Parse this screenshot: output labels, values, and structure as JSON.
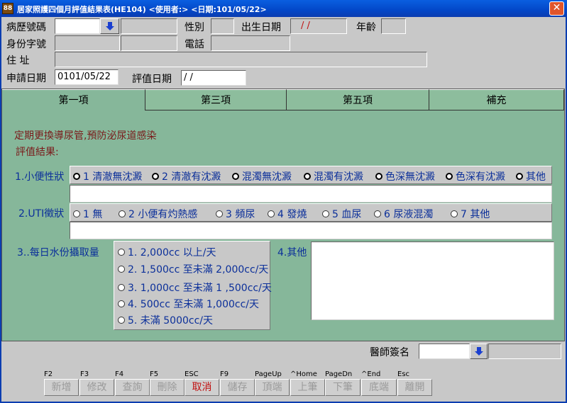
{
  "window": {
    "title": "居家照護四個月評值結果表(HE104)   <使用者:>    <日期:101/05/22>",
    "app_icon_text": "88",
    "close_label": "✕"
  },
  "header": {
    "record_no_label": "病歷號碼",
    "gender_label": "性別",
    "birthdate_label": "出生日期",
    "birthdate_value": "/ /",
    "age_label": "年齡",
    "id_label": "身份字號",
    "phone_label": "電話",
    "address_label": "住    址",
    "apply_date_label": "申請日期",
    "apply_date_value": "0101/05/22",
    "eval_date_label": "評值日期",
    "eval_date_value": " / /"
  },
  "tabs": [
    {
      "label": "第一項"
    },
    {
      "label": "第三項"
    },
    {
      "label": "第五項"
    },
    {
      "label": "補充"
    }
  ],
  "panel": {
    "heading": "定期更換導尿管,預防泌尿道感染",
    "result_label": "評值結果:",
    "q1_label": "1.小便性狀",
    "q1_options": [
      "1 清澈無沈澱",
      "2 清澈有沈澱",
      "混濁無沈澱",
      "混濁有沈澱",
      "色深無沈澱",
      "色深有沈澱",
      "其他"
    ],
    "q2_label": "2.UTI徵狀",
    "q2_options": [
      "1 無",
      "2 小便有灼熱感",
      "3 頻尿",
      "4 發燒",
      "5 血尿",
      "6 尿液混濁",
      "7 其他"
    ],
    "q3_label": "3..每日水份攝取量",
    "q3_options": [
      "1. 2,000cc 以上/天",
      "2. 1,500cc 至未滿 2,000cc/天",
      "3. 1,000cc 至未滿 1 ,500cc/天",
      "4. 500cc 至未滿 1,000cc/天",
      "5. 未滿 5000cc/天"
    ],
    "q4_label": "4.其他"
  },
  "footer": {
    "doctor_sign_label": "醫師簽名",
    "buttons": [
      {
        "key": "F2",
        "label": "新增"
      },
      {
        "key": "F3",
        "label": "修改"
      },
      {
        "key": "F4",
        "label": "查詢"
      },
      {
        "key": "F5",
        "label": "刪除"
      },
      {
        "key": "ESC",
        "label": "取消"
      },
      {
        "key": "F9",
        "label": "儲存"
      },
      {
        "key": "PageUp",
        "label": "頂端"
      },
      {
        "key": "^Home",
        "label": "上筆"
      },
      {
        "key": "PageDn",
        "label": "下筆"
      },
      {
        "key": "^End",
        "label": "底端"
      },
      {
        "key": "Esc",
        "label": "離開"
      }
    ]
  },
  "colors": {
    "titlebar": "#0347c8",
    "panel_green": "#86b79a",
    "label_blue": "#0b2f9a",
    "heading_red": "#7a1a1a",
    "cancel_red": "#c01010"
  }
}
